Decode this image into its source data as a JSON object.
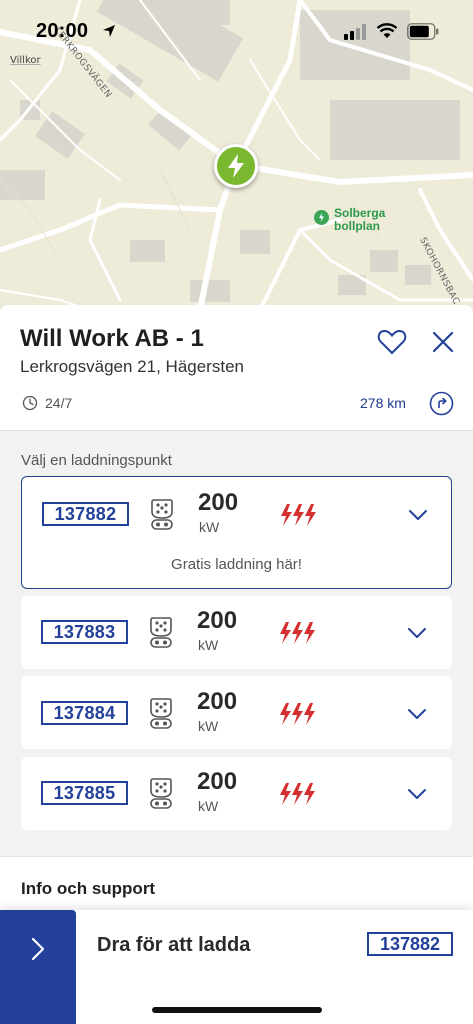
{
  "status_bar": {
    "time": "20:00"
  },
  "map": {
    "labels": {
      "villkor": "Villkor",
      "road_left": "LERKROGSVÄGEN",
      "road_right": "SKOHORNSBAC"
    },
    "poi": {
      "name_line1": "Solberga",
      "name_line2": "bollplan"
    },
    "colors": {
      "land": "#eeebd9",
      "roads": "#ffffff",
      "buildings": "#d8d6cc",
      "pin": "#7ab82f",
      "poi": "#3aa655"
    }
  },
  "station": {
    "title": "Will Work AB - 1",
    "address": "Lerkrogsvägen 21, Hägersten",
    "hours": "24/7",
    "distance": "278 km"
  },
  "charge_points": {
    "section_label": "Välj en laddningspunkt",
    "items": [
      {
        "id": "137882",
        "power": "200",
        "unit": "kW",
        "note": "Gratis laddning här!",
        "selected": true
      },
      {
        "id": "137883",
        "power": "200",
        "unit": "kW"
      },
      {
        "id": "137884",
        "power": "200",
        "unit": "kW"
      },
      {
        "id": "137885",
        "power": "200",
        "unit": "kW"
      }
    ]
  },
  "info": {
    "title": "Info och support"
  },
  "bottom_bar": {
    "label": "Dra för att ladda",
    "selected_id": "137882"
  },
  "theme": {
    "accent": "#23419a",
    "bolt_red": "#d32f2f",
    "text": "#222222"
  }
}
